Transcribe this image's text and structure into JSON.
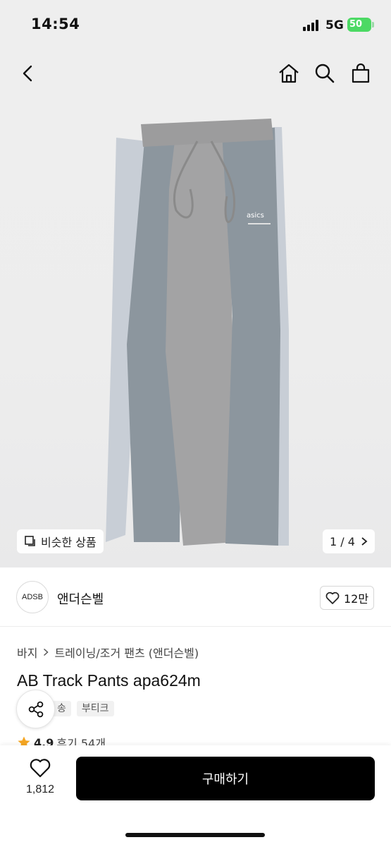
{
  "status": {
    "time": "14:54",
    "network": "5G",
    "battery": "50"
  },
  "nav": {
    "back": "back-icon",
    "home": "home-icon",
    "search": "search-icon",
    "cart": "shopping-bag-icon"
  },
  "image": {
    "similar_label": "비슷한 상품",
    "pager": "1 / 4"
  },
  "shop": {
    "logo_text": "ADSB",
    "name": "앤더슨벨",
    "likes": "12만"
  },
  "breadcrumb": {
    "category": "바지",
    "subcategory": "트레이닝/조거 팬츠 (앤더슨벨)"
  },
  "product": {
    "title": "AB Track Pants apa624m",
    "tags": [
      "송",
      "부티크"
    ],
    "rating": "4.9",
    "reviews": "후기 54개"
  },
  "bottom": {
    "wish_count": "1,812",
    "buy_label": "구매하기"
  },
  "colors": {
    "accent": "#000000",
    "star": "#f5a623",
    "battery": "#4cd964"
  }
}
